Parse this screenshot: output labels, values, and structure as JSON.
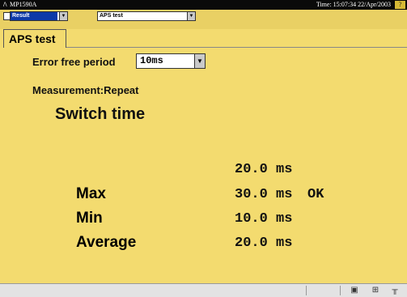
{
  "titlebar": {
    "logo": "/\\",
    "app_name": "MP1590A",
    "time_label": "Time: 15:07:34 22/Apr/2003",
    "help_label": "?"
  },
  "toolbar": {
    "result_select": "Result",
    "aps_select": "APS test"
  },
  "tab": {
    "label": "APS test"
  },
  "error_free_period": {
    "label": "Error free period",
    "value": "10ms"
  },
  "measurement_mode": "Measurement:Repeat",
  "switch_time": {
    "title": "Switch time",
    "current": "20.0 ms",
    "rows": [
      {
        "label": "Max",
        "value": "30.0 ms",
        "status": "OK"
      },
      {
        "label": "Min",
        "value": "10.0 ms",
        "status": ""
      },
      {
        "label": "Average",
        "value": "20.0 ms",
        "status": ""
      }
    ]
  },
  "statusbar_icons": [
    "printer-icon",
    "window-icon",
    "settings-icon"
  ]
}
